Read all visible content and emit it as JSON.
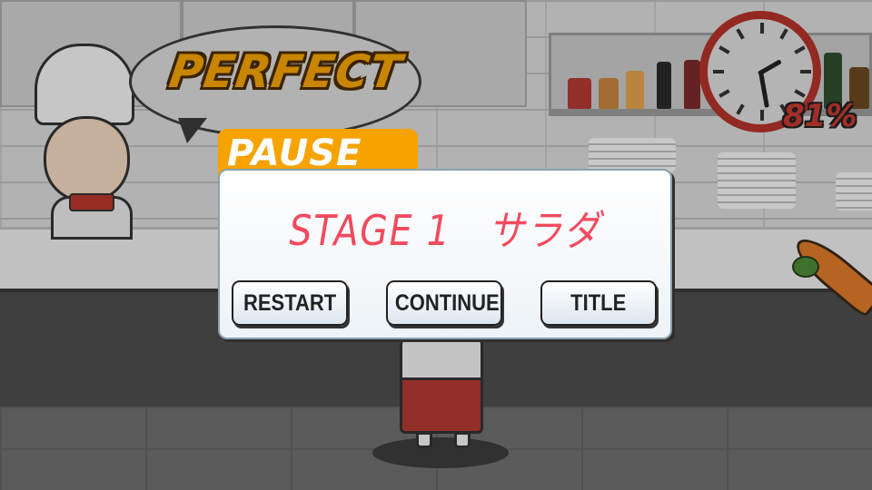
{
  "banner": {
    "text": "PERFECT"
  },
  "timer": {
    "percent_label": "81%",
    "hand_position": "about 7 o'clock"
  },
  "pause_dialog": {
    "title": "PAUSE",
    "stage_label": "STAGE 1　サラダ",
    "buttons": {
      "restart": "RESTART",
      "continue": "CONTINUE",
      "title": "TITLE"
    }
  },
  "colors": {
    "accent_orange": "#f6a300",
    "stage_text": "#f24a5e",
    "clock_rim": "#b3322a",
    "timer_text": "#c53a30"
  }
}
